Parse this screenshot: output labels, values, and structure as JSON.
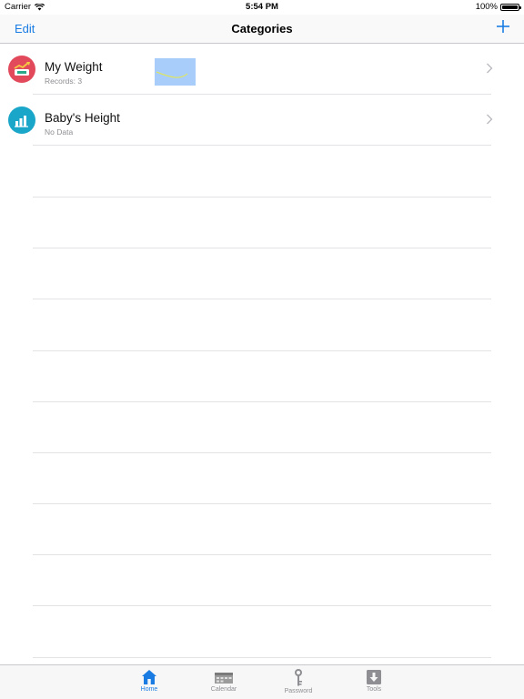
{
  "status_bar": {
    "carrier": "Carrier",
    "time": "5:54 PM",
    "battery": "100%"
  },
  "nav": {
    "edit_label": "Edit",
    "title": "Categories",
    "add_icon": "plus-icon"
  },
  "categories": [
    {
      "title": "My Weight",
      "subtitle": "Records: 3",
      "icon": "weight-scale-icon",
      "icon_color": "#e24a5c"
    },
    {
      "title": "Baby's Height",
      "subtitle": "No Data",
      "icon": "bar-chart-icon",
      "icon_color": "#1aa6c8"
    }
  ],
  "tab_bar": {
    "tabs": [
      {
        "label": "Home",
        "icon": "home-icon",
        "active": true
      },
      {
        "label": "Calendar",
        "icon": "calendar-icon",
        "active": false
      },
      {
        "label": "Password",
        "icon": "key-icon",
        "active": false
      },
      {
        "label": "Tools",
        "icon": "download-icon",
        "active": false
      }
    ]
  },
  "colors": {
    "accent": "#1a7ce3",
    "separator": "#e3e3e6"
  }
}
